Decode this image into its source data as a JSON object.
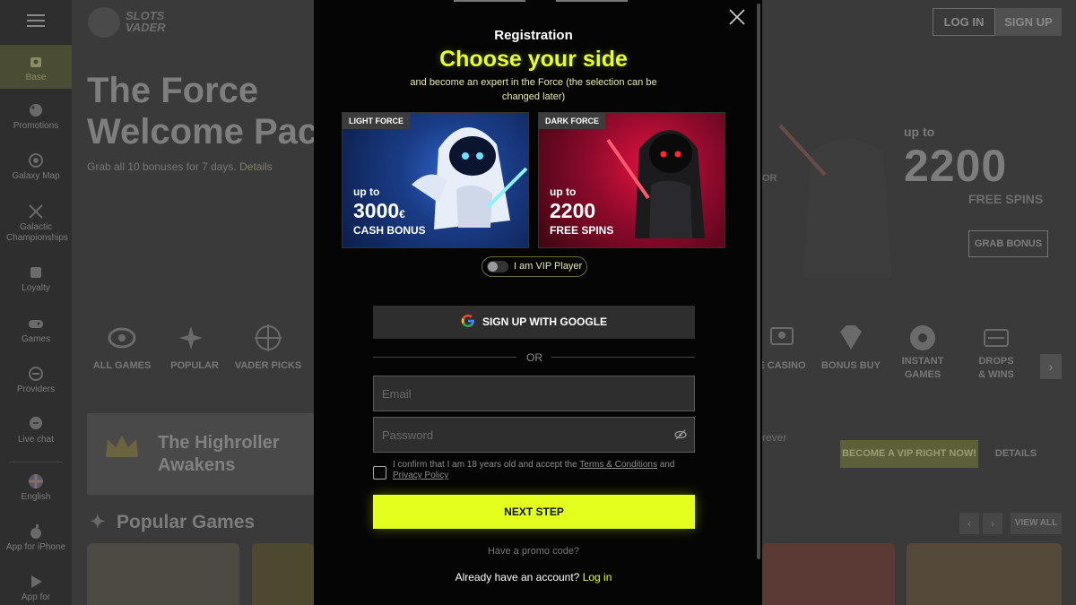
{
  "sidebar": {
    "items": [
      {
        "label": "Base",
        "icon": "home-icon"
      },
      {
        "label": "Promotions",
        "icon": "promotions-icon"
      },
      {
        "label": "Galaxy Map",
        "icon": "galaxy-map-icon"
      },
      {
        "label": "Galactic Championships",
        "icon": "swords-icon"
      },
      {
        "label": "Loyalty",
        "icon": "loyalty-icon"
      },
      {
        "label": "Games",
        "icon": "gamepad-icon"
      },
      {
        "label": "Providers",
        "icon": "providers-icon"
      },
      {
        "label": "Live chat",
        "icon": "chat-icon"
      },
      {
        "label": "English",
        "icon": "uk-flag-icon"
      },
      {
        "label": "App for iPhone",
        "icon": "apple-icon"
      },
      {
        "label": "App for",
        "icon": "play-icon"
      }
    ]
  },
  "header": {
    "logo_line1": "SLOTS",
    "logo_line2": "VADER",
    "login_label": "LOG IN",
    "signup_label": "SIGN UP"
  },
  "hero": {
    "title_line1": "The Force",
    "title_line2": "Welcome Pac",
    "subtitle": "Grab all 10 bonuses for 7 days.",
    "details_link": "Details",
    "or_text": "OR",
    "right_upto": "up to",
    "right_amount": "2200",
    "right_label": "FREE SPINS",
    "grab_label": "GRAB BONUS"
  },
  "categories": [
    {
      "label": "ALL GAMES",
      "icon": "galaxy-icon"
    },
    {
      "label": "POPULAR",
      "icon": "sparkle-icon"
    },
    {
      "label": "VADER PICKS",
      "icon": "crosshair-icon"
    },
    {
      "label": "E CASINO",
      "icon": "live-casino-icon"
    },
    {
      "label": "BONUS BUY",
      "icon": "diamond-icon"
    },
    {
      "label": "INSTANT GAMES",
      "icon": "instant-games-icon"
    },
    {
      "label": "DROPS & WINS",
      "icon": "drops-wins-icon"
    }
  ],
  "vip_band": {
    "title_line1": "The Highroller",
    "title_line2": "Awakens",
    "forever_text": "rever",
    "become_vip": "BECOME A VIP RIGHT NOW!",
    "details": "DETAILS"
  },
  "popular": {
    "title": "Popular Games",
    "view_all": "VIEW ALL"
  },
  "modal": {
    "title": "Registration",
    "headline": "Choose your side",
    "subtitle": "and become an expert in the Force (the selection can be changed later)",
    "light_card": {
      "tag": "LIGHT FORCE",
      "upto": "up to",
      "amount": "3000",
      "currency": "€",
      "label": "CASH BONUS"
    },
    "dark_card": {
      "tag": "DARK FORCE",
      "upto": "up to",
      "amount": "2200",
      "label": "FREE SPINS"
    },
    "vip_label": "I am VIP Player",
    "google_label": "SIGN UP WITH GOOGLE",
    "or_label": "OR",
    "email_placeholder": "Email",
    "password_placeholder": "Password",
    "terms_prefix": "I confirm that I am 18 years old and accept the",
    "terms_link": "Terms & Conditions",
    "terms_and": "and",
    "privacy_link": "Privacy Policy",
    "next_label": "NEXT STEP",
    "promo_label": "Have a promo code?",
    "have_account": "Already have an account?",
    "login_link": "Log in"
  },
  "colors": {
    "accent": "#e4ff1d",
    "modal_bg": "#050505",
    "backdrop": "#3a3a3a"
  }
}
